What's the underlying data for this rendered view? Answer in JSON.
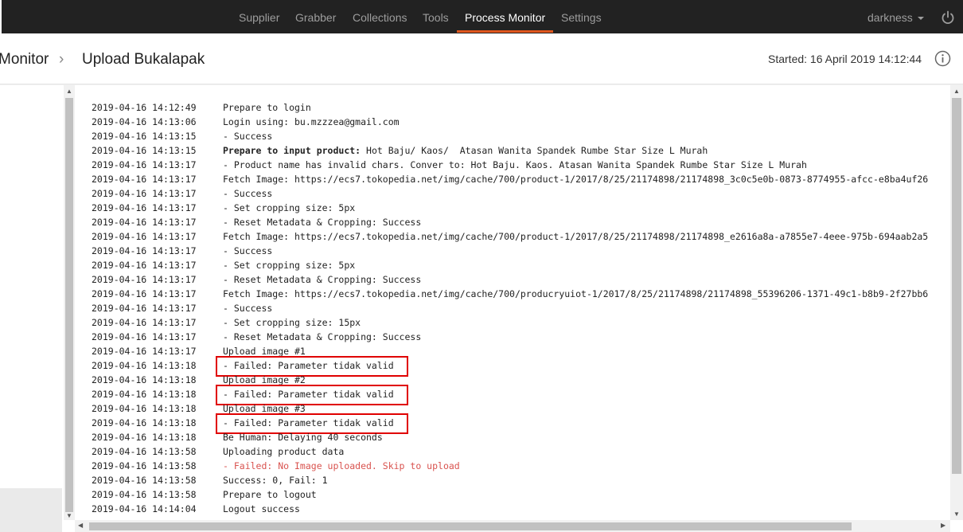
{
  "nav": {
    "items": [
      {
        "label": "Supplier",
        "active": false
      },
      {
        "label": "Grabber",
        "active": false
      },
      {
        "label": "Collections",
        "active": false
      },
      {
        "label": "Tools",
        "active": false
      },
      {
        "label": "Process Monitor",
        "active": true
      },
      {
        "label": "Settings",
        "active": false
      }
    ],
    "user": "darkness",
    "accent": "#e0571d",
    "icons": {
      "power": "power-icon",
      "caret": "caret-down-icon"
    }
  },
  "header": {
    "breadcrumb_prev": "Monitor",
    "breadcrumb_sep": "›",
    "title": "Upload Bukalapak",
    "started": "Started: 16 April 2019 14:12:44",
    "info_icon": "info-icon"
  },
  "log": [
    {
      "ts": "2019-04-16 14:12:49",
      "msg": "Prepare to login"
    },
    {
      "ts": "2019-04-16 14:13:06",
      "msg": "Login using: bu.mzzzea@gmail.com"
    },
    {
      "ts": "2019-04-16 14:13:15",
      "msg": "- Success"
    },
    {
      "ts": "2019-04-16 14:13:15",
      "bold": "Prepare to input product:",
      "msg": " Hot Baju/ Kaos/  Atasan Wanita Spandek Rumbe Star Size L Murah"
    },
    {
      "ts": "2019-04-16 14:13:17",
      "msg": "- Product name has invalid chars. Conver to: Hot Baju. Kaos. Atasan Wanita Spandek Rumbe Star Size L Murah"
    },
    {
      "ts": "2019-04-16 14:13:17",
      "msg": "Fetch Image: https://ecs7.tokopedia.net/img/cache/700/product-1/2017/8/25/21174898/21174898_3c0c5e0b-0873-8774955-afcc-e8ba4uf26"
    },
    {
      "ts": "2019-04-16 14:13:17",
      "msg": "- Success"
    },
    {
      "ts": "2019-04-16 14:13:17",
      "msg": "- Set cropping size: 5px"
    },
    {
      "ts": "2019-04-16 14:13:17",
      "msg": "- Reset Metadata & Cropping: Success"
    },
    {
      "ts": "2019-04-16 14:13:17",
      "msg": "Fetch Image: https://ecs7.tokopedia.net/img/cache/700/product-1/2017/8/25/21174898/21174898_e2616a8a-a7855e7-4eee-975b-694aab2a5"
    },
    {
      "ts": "2019-04-16 14:13:17",
      "msg": "- Success"
    },
    {
      "ts": "2019-04-16 14:13:17",
      "msg": "- Set cropping size: 5px"
    },
    {
      "ts": "2019-04-16 14:13:17",
      "msg": "- Reset Metadata & Cropping: Success"
    },
    {
      "ts": "2019-04-16 14:13:17",
      "msg": "Fetch Image: https://ecs7.tokopedia.net/img/cache/700/producryuiot-1/2017/8/25/21174898/21174898_55396206-1371-49c1-b8b9-2f27bb6"
    },
    {
      "ts": "2019-04-16 14:13:17",
      "msg": "- Success"
    },
    {
      "ts": "2019-04-16 14:13:17",
      "msg": "- Set cropping size: 15px"
    },
    {
      "ts": "2019-04-16 14:13:17",
      "msg": "- Reset Metadata & Cropping: Success"
    },
    {
      "ts": "2019-04-16 14:13:17",
      "msg": "Upload image #1"
    },
    {
      "ts": "2019-04-16 14:13:18",
      "msg": "- Failed: Parameter tidak valid",
      "highlight": true
    },
    {
      "ts": "2019-04-16 14:13:18",
      "msg": "Upload image #2"
    },
    {
      "ts": "2019-04-16 14:13:18",
      "msg": "- Failed: Parameter tidak valid",
      "highlight": true
    },
    {
      "ts": "2019-04-16 14:13:18",
      "msg": "Upload image #3"
    },
    {
      "ts": "2019-04-16 14:13:18",
      "msg": "- Failed: Parameter tidak valid",
      "highlight": true
    },
    {
      "ts": "2019-04-16 14:13:18",
      "msg": "Be Human: Delaying 40 seconds"
    },
    {
      "ts": "2019-04-16 14:13:58",
      "msg": "Uploading product data"
    },
    {
      "ts": "2019-04-16 14:13:58",
      "msg": "- Failed: No Image uploaded. Skip to upload",
      "error": true
    },
    {
      "ts": "2019-04-16 14:13:58",
      "msg": "Success: 0, Fail: 1"
    },
    {
      "ts": "2019-04-16 14:13:58",
      "msg": "Prepare to logout"
    },
    {
      "ts": "2019-04-16 14:14:04",
      "msg": "Logout success"
    }
  ],
  "colors": {
    "highlight_border": "#e00000",
    "error_text": "#d9534f"
  }
}
